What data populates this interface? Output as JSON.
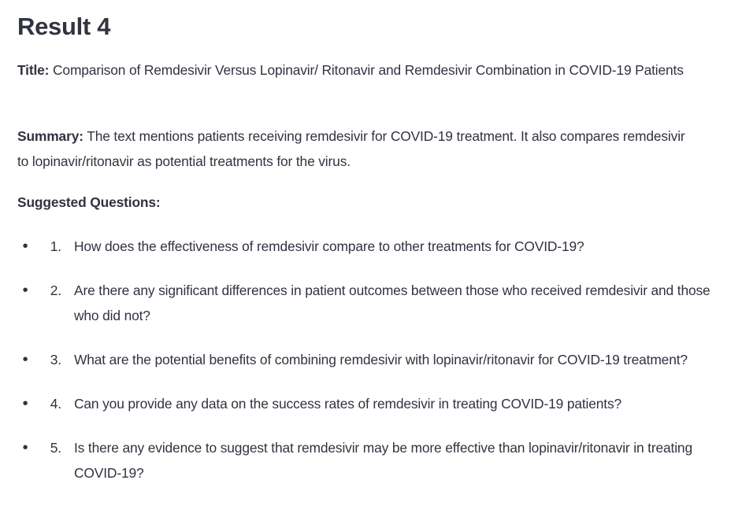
{
  "heading": "Result 4",
  "title_label": "Title:",
  "title_text": " Comparison of Remdesivir Versus Lopinavir/ Ritonavir and Remdesivir Combination in COVID-19 Patients",
  "summary_label": "Summary:",
  "summary_text": " The text mentions patients receiving remdesivir for COVID-19 treatment. It also compares remdesivir to lopinavir/ritonavir as potential treatments for the virus.",
  "questions_label": "Suggested Questions:",
  "questions": [
    {
      "num": "1.",
      "text": "How does the effectiveness of remdesivir compare to other treatments for COVID-19?"
    },
    {
      "num": "2.",
      "text": "Are there any significant differences in patient outcomes between those who received remdesivir and those who did not?"
    },
    {
      "num": "3.",
      "text": "What are the potential benefits of combining remdesivir with lopinavir/ritonavir for COVID-19 treatment?"
    },
    {
      "num": "4.",
      "text": "Can you provide any data on the success rates of remdesivir in treating COVID-19 patients?"
    },
    {
      "num": "5.",
      "text": "Is there any evidence to suggest that remdesivir may be more effective than lopinavir/ritonavir in treating COVID-19?"
    }
  ]
}
